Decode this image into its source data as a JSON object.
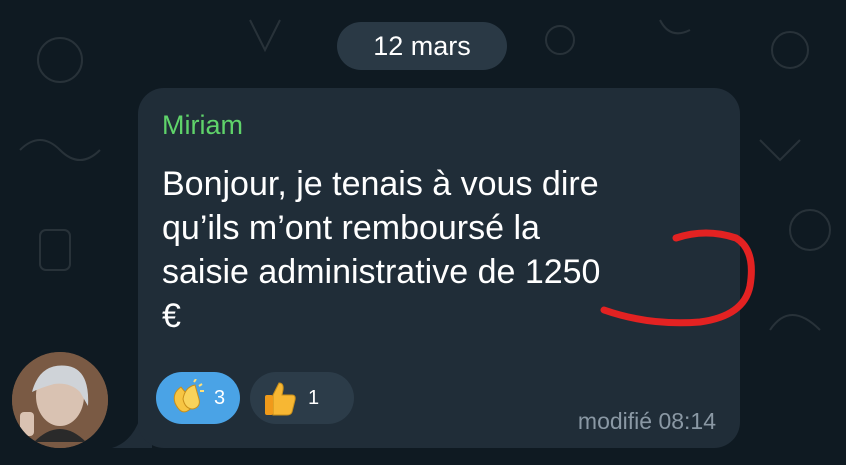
{
  "date_separator": "12 mars",
  "message": {
    "sender": "Miriam",
    "text": "Bonjour, je tenais à vous dire\nqu’ils m’ont remboursé la\nsaisie administrative de 1250\n€",
    "edited_label": "modifié 08:14"
  },
  "reactions": [
    {
      "emoji": "clapping-hands-icon",
      "count": "3",
      "selected": true
    },
    {
      "emoji": "thumbs-up-icon",
      "count": "1",
      "selected": false
    }
  ],
  "colors": {
    "background": "#0f1a22",
    "bubble": "#202d38",
    "sender_name": "#5fd36a",
    "reaction_selected": "#4aa3e6",
    "reaction_unselected": "#2c3c49",
    "annotation": "#e32222"
  }
}
